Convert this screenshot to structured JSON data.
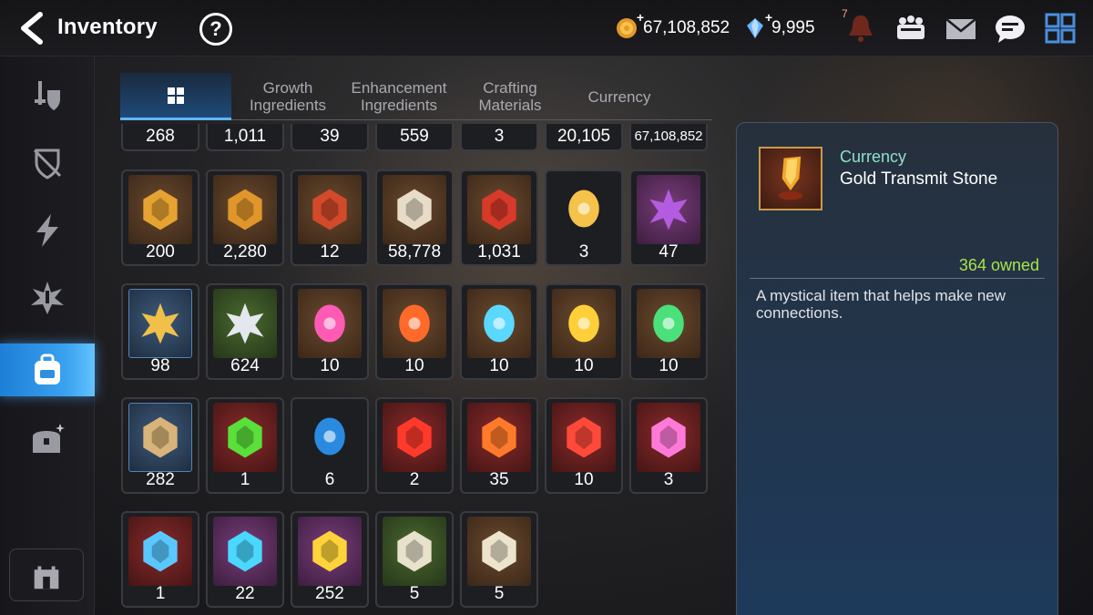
{
  "header": {
    "title": "Inventory",
    "help_label": "?",
    "gold": "67,108,852",
    "gems": "9,995",
    "bell_badge": "7",
    "plus": "+"
  },
  "sidebar": {
    "items": [
      {
        "icon": "equipment-shield-icon"
      },
      {
        "icon": "artifact-shield-icon"
      },
      {
        "icon": "lightning-icon"
      },
      {
        "icon": "spirit-burst-icon"
      },
      {
        "icon": "backpack-icon",
        "active": true
      },
      {
        "icon": "treasure-chest-icon"
      }
    ],
    "guild_icon": "castle-icon"
  },
  "tabs": [
    {
      "label": "",
      "icon": "grid-icon",
      "active": true
    },
    {
      "label": "Growth Ingredients"
    },
    {
      "label": "Enhancement Ingredients"
    },
    {
      "label": "Crafting Materials"
    },
    {
      "label": "Currency"
    }
  ],
  "partial_row": [
    "268",
    "1,011",
    "39",
    "559",
    "3",
    "20,105",
    "67,108,852"
  ],
  "rows": [
    [
      {
        "count": "200",
        "icon": "hexagon-badge-icon",
        "frame": "brown"
      },
      {
        "count": "2,280",
        "icon": "fist-badge-icon",
        "frame": "brown"
      },
      {
        "count": "12",
        "icon": "banner-icon",
        "frame": "brown"
      },
      {
        "count": "58,778",
        "icon": "knight-chess-icon",
        "frame": "brown"
      },
      {
        "count": "1,031",
        "icon": "red-crest-icon",
        "frame": "brown"
      },
      {
        "count": "3",
        "icon": "chibi-portrait-icon",
        "frame": "round"
      },
      {
        "count": "47",
        "icon": "purple-flower-icon",
        "frame": "purple"
      }
    ],
    [
      {
        "count": "98",
        "icon": "gold-lotus-icon",
        "frame": "blue"
      },
      {
        "count": "624",
        "icon": "silver-lotus-icon",
        "frame": "green"
      },
      {
        "count": "10",
        "icon": "pink-rune-icon",
        "frame": "brown"
      },
      {
        "count": "10",
        "icon": "fire-rune-icon",
        "frame": "brown"
      },
      {
        "count": "10",
        "icon": "ice-rune-icon",
        "frame": "brown"
      },
      {
        "count": "10",
        "icon": "light-rune-icon",
        "frame": "brown"
      },
      {
        "count": "10",
        "icon": "nature-rune-icon",
        "frame": "brown"
      }
    ],
    [
      {
        "count": "282",
        "icon": "ginseng-root-icon",
        "frame": "blue"
      },
      {
        "count": "1",
        "icon": "green-potion-icon",
        "frame": "red"
      },
      {
        "count": "6",
        "icon": "blue-orb-icon",
        "frame": "round"
      },
      {
        "count": "2",
        "icon": "red-crystal-icon",
        "frame": "red"
      },
      {
        "count": "35",
        "icon": "red-stone-icon",
        "frame": "red"
      },
      {
        "count": "10",
        "icon": "red-gem-icon",
        "frame": "red"
      },
      {
        "count": "3",
        "icon": "pink-flask-icon",
        "frame": "red"
      }
    ],
    [
      {
        "count": "1",
        "icon": "blue-hammer-stone-icon",
        "frame": "red"
      },
      {
        "count": "22",
        "icon": "dark-star-stone-icon",
        "frame": "purple"
      },
      {
        "count": "252",
        "icon": "gold-hammer-stone-icon",
        "frame": "purple"
      },
      {
        "count": "5",
        "icon": "white-star-stone-icon",
        "frame": "green"
      },
      {
        "count": "5",
        "icon": "white-hammer-stone-icon",
        "frame": "brown"
      }
    ]
  ],
  "detail": {
    "category": "Currency",
    "name": "Gold Transmit Stone",
    "owned": "364 owned",
    "description": "A mystical item that helps make new connections."
  },
  "colors": {
    "accent_blue": "#3aa2f0",
    "owned_green": "#a8e24a",
    "category_teal": "#8ee0c8"
  }
}
